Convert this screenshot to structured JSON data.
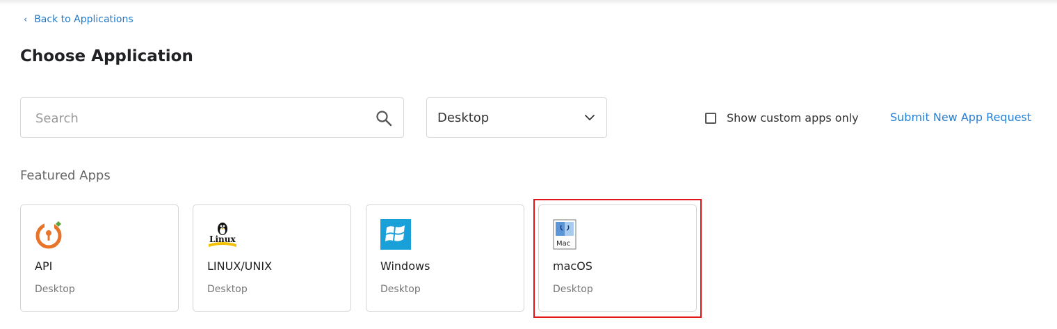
{
  "nav": {
    "back_label": "Back to Applications"
  },
  "page": {
    "title": "Choose Application"
  },
  "filters": {
    "search_placeholder": "Search",
    "search_value": "",
    "platform_selected": "Desktop",
    "custom_only_label": "Show custom apps only",
    "custom_only_checked": false,
    "submit_request_label": "Submit New App Request"
  },
  "featured": {
    "title": "Featured Apps",
    "apps": [
      {
        "name": "API",
        "category": "Desktop",
        "icon": "api-key-icon"
      },
      {
        "name": "LINUX/UNIX",
        "category": "Desktop",
        "icon": "linux-penguin-icon",
        "logo_text": "Linux"
      },
      {
        "name": "Windows",
        "category": "Desktop",
        "icon": "windows-logo-icon"
      },
      {
        "name": "macOS",
        "category": "Desktop",
        "icon": "mac-finder-icon",
        "logo_text": "Mac"
      }
    ]
  },
  "colors": {
    "link": "#1f78c8",
    "highlight": "#e3141a",
    "api_orange": "#e8742a",
    "windows_blue": "#1aa0d8"
  }
}
